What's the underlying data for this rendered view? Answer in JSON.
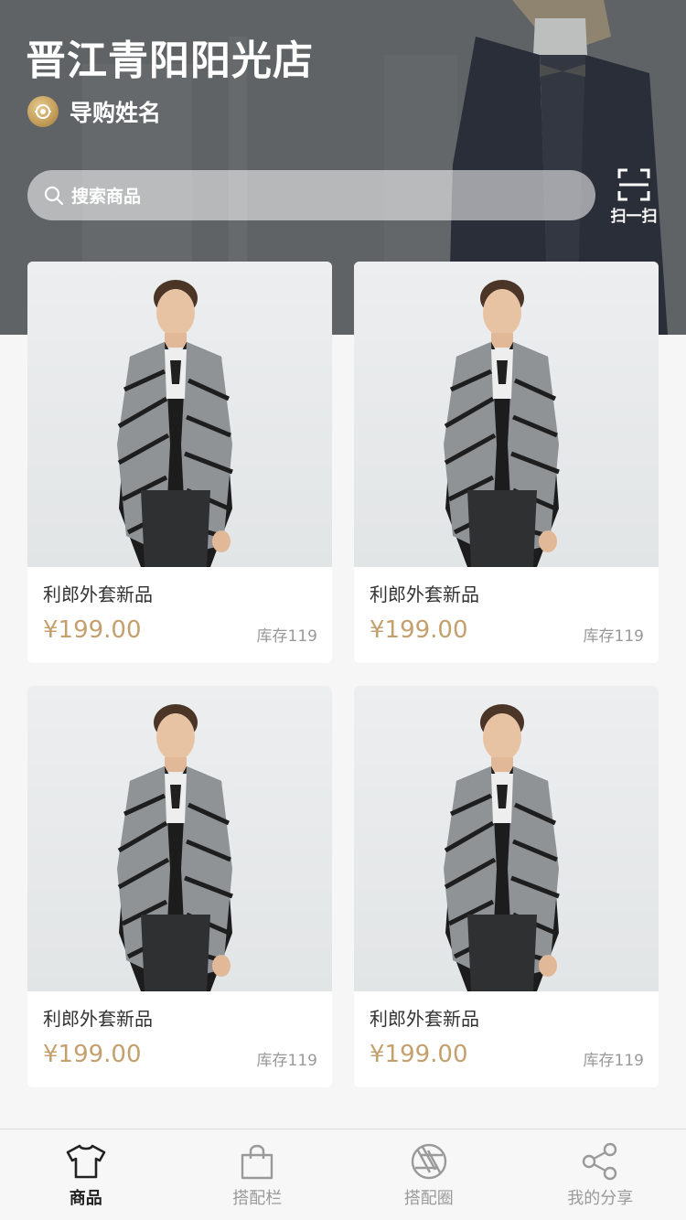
{
  "header": {
    "store_name": "晋江青阳阳光店",
    "guide_name": "导购姓名",
    "search_placeholder": "搜索商品",
    "scan_label": "扫一扫"
  },
  "products": [
    {
      "name": "利郎外套新品",
      "price": "¥199.00",
      "stock": "库存119"
    },
    {
      "name": "利郎外套新品",
      "price": "¥199.00",
      "stock": "库存119"
    },
    {
      "name": "利郎外套新品",
      "price": "¥199.00",
      "stock": "库存119"
    },
    {
      "name": "利郎外套新品",
      "price": "¥199.00",
      "stock": "库存119"
    }
  ],
  "tabbar": {
    "items": [
      {
        "label": "商品",
        "icon": "tshirt-icon",
        "active": true
      },
      {
        "label": "搭配栏",
        "icon": "shopping-bag-icon",
        "active": false
      },
      {
        "label": "搭配圈",
        "icon": "aperture-icon",
        "active": false
      },
      {
        "label": "我的分享",
        "icon": "share-icon",
        "active": false
      }
    ]
  },
  "colors": {
    "price": "#c4a06e",
    "active_tab": "#222222",
    "inactive_tab": "#9a9a9a"
  }
}
